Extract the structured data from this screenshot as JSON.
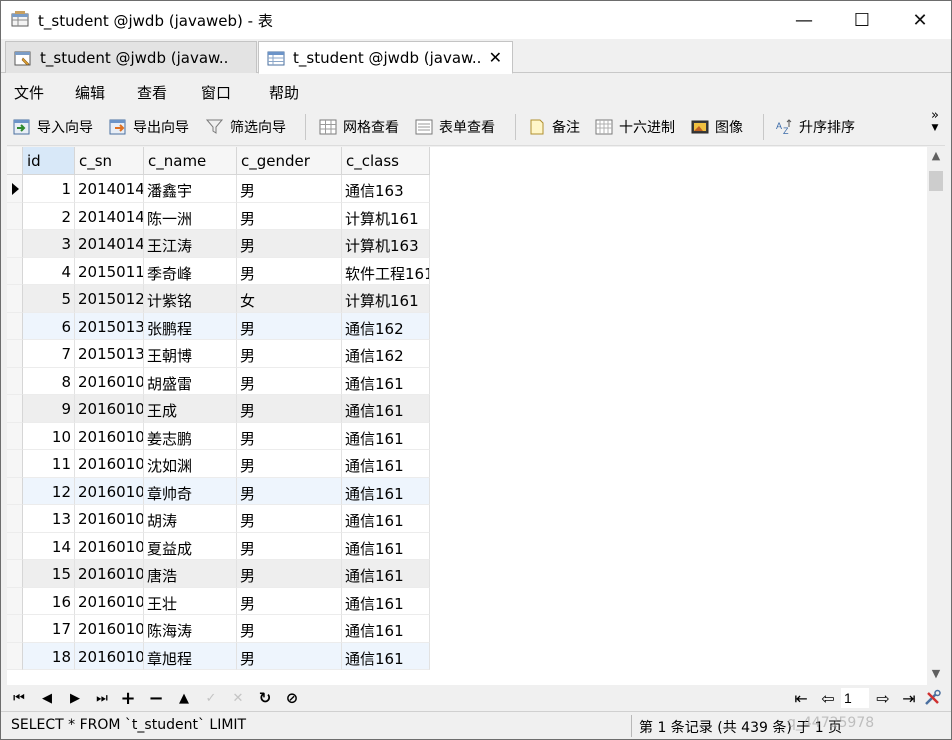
{
  "window": {
    "title": "t_student @jwdb (javaweb) - 表",
    "minimize": "—",
    "maximize": "☐",
    "close": "✕"
  },
  "tabs": [
    {
      "label": "t_student @jwdb (javaw...",
      "icon": "query-icon",
      "active": false
    },
    {
      "label": "t_student @jwdb (javaw...",
      "icon": "table-icon",
      "active": true,
      "close": "✕"
    }
  ],
  "menu": [
    "文件",
    "编辑",
    "查看",
    "窗口",
    "帮助"
  ],
  "toolbar": {
    "import_wizard": "导入向导",
    "export_wizard": "导出向导",
    "filter_wizard": "筛选向导",
    "grid_view": "网格查看",
    "form_view": "表单查看",
    "memo": "备注",
    "hex": "十六进制",
    "image": "图像",
    "sort_asc": "升序排序",
    "more": "»"
  },
  "grid": {
    "columns": [
      "id",
      "c_sn",
      "c_name",
      "c_gender",
      "c_class"
    ],
    "rows": [
      [
        "1",
        "2014014",
        "潘鑫宇",
        "男",
        "通信163"
      ],
      [
        "2",
        "2014014",
        "陈一洲",
        "男",
        "计算机161"
      ],
      [
        "3",
        "2014014",
        "王江涛",
        "男",
        "计算机163"
      ],
      [
        "4",
        "2015011",
        "季奇峰",
        "男",
        "软件工程161"
      ],
      [
        "5",
        "2015012",
        "计紫铭",
        "女",
        "计算机161"
      ],
      [
        "6",
        "2015013",
        "张鹏程",
        "男",
        "通信162"
      ],
      [
        "7",
        "2015013",
        "王朝博",
        "男",
        "通信162"
      ],
      [
        "8",
        "2016010",
        "胡盛雷",
        "男",
        "通信161"
      ],
      [
        "9",
        "2016010",
        "王成",
        "男",
        "通信161"
      ],
      [
        "10",
        "2016010",
        "姜志鹏",
        "男",
        "通信161"
      ],
      [
        "11",
        "2016010",
        "沈如渊",
        "男",
        "通信161"
      ],
      [
        "12",
        "2016010",
        "章帅奇",
        "男",
        "通信161"
      ],
      [
        "13",
        "2016010",
        "胡涛",
        "男",
        "通信161"
      ],
      [
        "14",
        "2016010",
        "夏益成",
        "男",
        "通信161"
      ],
      [
        "15",
        "2016010",
        "唐浩",
        "男",
        "通信161"
      ],
      [
        "16",
        "2016010",
        "王壮",
        "男",
        "通信161"
      ],
      [
        "17",
        "2016010",
        "陈海涛",
        "男",
        "通信161"
      ],
      [
        "18",
        "2016010",
        "章旭程",
        "男",
        "通信161"
      ]
    ]
  },
  "nav": {
    "first": "⏮",
    "prev": "◀",
    "next": "▶",
    "last": "⏭",
    "add": "+",
    "delete": "−",
    "up": "▲",
    "apply": "✓",
    "discard": "✕",
    "refresh": "↻",
    "stop": "⊘",
    "page_first": "⇤",
    "page_prev": "⇦",
    "page_value": "1",
    "page_next": "⇨",
    "page_last": "⇥"
  },
  "status": {
    "sql": "SELECT * FROM `t_student` LIMIT",
    "records": "第 1 条记录 (共 439 条) 于 1 页",
    "watermark": "q_44725978"
  }
}
